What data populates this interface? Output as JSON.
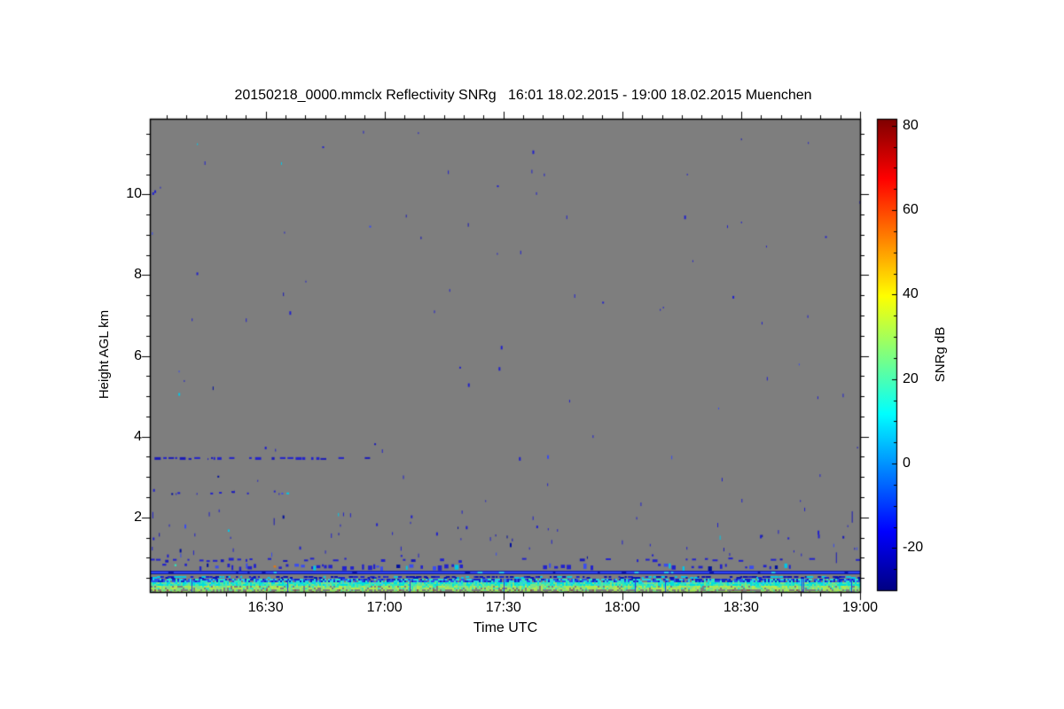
{
  "chart_data": {
    "type": "heatmap",
    "title": "20150218_0000.mmclx Reflectivity SNRg   16:01 18.02.2015 - 19:00 18.02.2015 Muenchen",
    "xlabel": "Time UTC",
    "ylabel": "Height AGL km",
    "x_axis": {
      "start_utc": "16:01",
      "end_utc": "19:00",
      "total_minutes": 179,
      "major_ticks": [
        {
          "label": "16:30",
          "minute": 29
        },
        {
          "label": "17:00",
          "minute": 59
        },
        {
          "label": "17:30",
          "minute": 89
        },
        {
          "label": "18:00",
          "minute": 119
        },
        {
          "label": "18:30",
          "minute": 149
        },
        {
          "label": "19:00",
          "minute": 179
        }
      ],
      "minor_step_minutes": 5
    },
    "y_axis": {
      "units": "km",
      "min": 0.15,
      "max": 11.85,
      "major_ticks": [
        2,
        4,
        6,
        8,
        10
      ],
      "minor_step": 0.5
    },
    "colorbar": {
      "label": "SNRg dB",
      "vmin": -30,
      "vmax": 81.4,
      "major_ticks": [
        80,
        60,
        40,
        20,
        0,
        -20
      ],
      "minor_step": 5,
      "colormap": "jet",
      "position": "right"
    },
    "no_data_color": "#7e7e7e",
    "palette": {
      "speck_blue": "#2222cc",
      "speck_dark_blue": "#1a1ab8",
      "speck_bright_blue": "#3a4cee",
      "speck_navy": "#000f9e",
      "speck_cyan": "#00c8e8",
      "line_core": "#2e44f4",
      "line_edge": "#161fa6",
      "band_cyan": "#00e0dc",
      "band_turquoise": "#2fe6bd",
      "band_green": "#7fe47f",
      "band_yellow_green": "#a8e45a",
      "band_dark_speck": "#8a5a50",
      "patch_orange": "#e07818"
    },
    "features": {
      "seed": 20150218,
      "boundary_layer_band": {
        "top_km": 0.49,
        "bottom_km": 0.17,
        "snr_db_range": [
          5,
          25
        ],
        "span": "full"
      },
      "plate_line": {
        "height_km": 0.63,
        "snr_db": -3,
        "span": "full"
      },
      "navy_speckle_row": {
        "height_km": 0.52,
        "snr_db": -22,
        "span": "full"
      },
      "speckle_row_1km": {
        "height_km": 0.97
      },
      "patch_row": {
        "height_km": 0.82,
        "clusters_min": [
          [
            2,
            26
          ],
          [
            31,
            58
          ],
          [
            62,
            79
          ],
          [
            99,
            113
          ],
          [
            128,
            147
          ],
          [
            150,
            162
          ]
        ]
      },
      "dashed_line": {
        "height_km": 3.49,
        "from_min": 0,
        "to_min": 56
      },
      "sparse_row": {
        "height_km": 2.64,
        "from_min": 0,
        "to_min": 36,
        "count": 14
      },
      "scatter_specks": {
        "upper_count": 82,
        "upper_km": [
          2.2,
          11.7
        ],
        "lower_count": 75,
        "lower_km": [
          1.03,
          2.2
        ]
      },
      "left_edge_specks": [
        [
          0.4,
          10.05
        ],
        [
          0.9,
          10.1
        ],
        [
          0.6,
          2.7
        ],
        [
          0.5,
          1.5
        ]
      ]
    }
  }
}
